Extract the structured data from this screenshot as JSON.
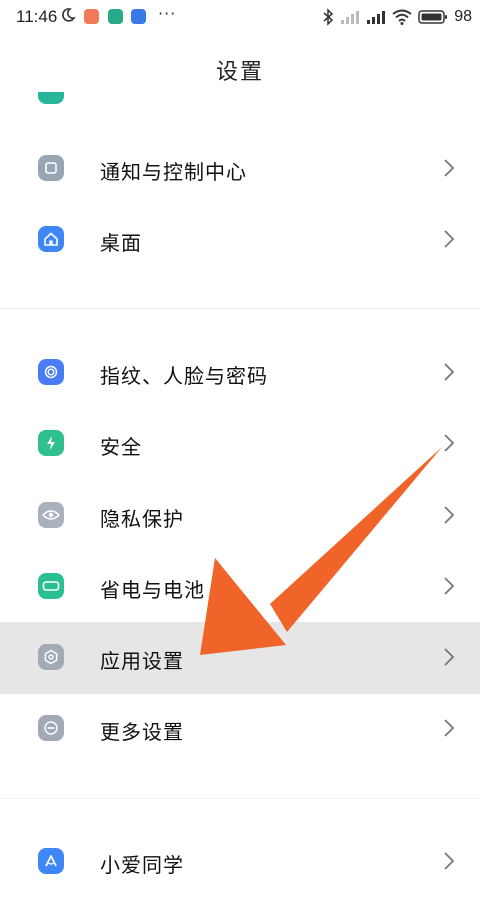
{
  "status_bar": {
    "time": "11:46",
    "battery": "98",
    "icons": [
      "moon-icon",
      "app-notification-icon",
      "app-notification-icon",
      "app-notification-icon",
      "more-icon",
      "bluetooth-icon",
      "signal-off-icon",
      "signal-icon",
      "wifi-icon",
      "battery-icon"
    ]
  },
  "page": {
    "title": "设置"
  },
  "settings": {
    "items": [
      {
        "label": "通知与控制中心",
        "icon": "notification-icon",
        "color": "#9aa5b4"
      },
      {
        "label": "桌面",
        "icon": "home-icon",
        "color": "#3f86f6"
      },
      {
        "label": "指纹、人脸与密码",
        "icon": "fingerprint-icon",
        "color": "#4a7df5"
      },
      {
        "label": "安全",
        "icon": "lightning-icon",
        "color": "#2fc08e"
      },
      {
        "label": "隐私保护",
        "icon": "eye-icon",
        "color": "#a9b1bd"
      },
      {
        "label": "省电与电池",
        "icon": "battery-icon",
        "color": "#2bbf95"
      },
      {
        "label": "应用设置",
        "icon": "hexagon-icon",
        "color": "#a2aab6"
      },
      {
        "label": "更多设置",
        "icon": "more-icon",
        "color": "#a2aab6"
      },
      {
        "label": "小爱同学",
        "icon": "xiaoai-icon",
        "color": "#3f86f6"
      }
    ]
  },
  "colors": {
    "arrow": "#f0642a",
    "highlight": "#e6e6e6"
  }
}
